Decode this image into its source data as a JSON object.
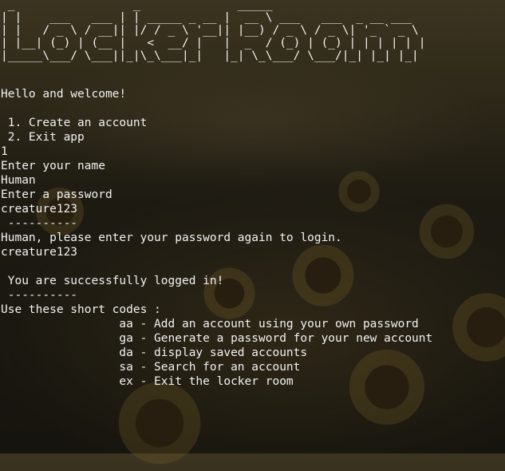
{
  "banner": {
    "ascii_art": " _                 _              _____                       \n| |    ___   ___ | | _____ _ __ |  __ \\ ___   ___  _ __ ___  \n| |   / _ \\ / __|| |/ / _ \\ '__|| |__) / _ \\ / _ \\| '_ ` _ \\ \n| |__| (_) | (__ |   <  __/ |   |  _  / (_) | (_) | | | | | |\n|_____\\___/ \\___||_|\\_\\___|_|   |_| \\_\\___/ \\___/|_| |_| |_|",
    "title": "Locker Room"
  },
  "terminal": {
    "welcome": "Hello and welcome!",
    "menu_option_1": " 1. Create an account",
    "menu_option_2": " 2. Exit app",
    "user_choice": "1",
    "prompt_name": "Enter your name",
    "input_name": "Human",
    "prompt_password": "Enter a password",
    "input_password": "creature123",
    "divider_1": " ----------",
    "login_prompt": "Human, please enter your password again to login.",
    "login_password": "creature123",
    "success_message": " You are successfully logged in!",
    "divider_2": " ----------",
    "short_codes_heading": "Use these short codes :",
    "codes": [
      "                 aa - Add an account using your own password",
      "                 ga - Generate a password for your new account",
      "                 da - display saved accounts",
      "                 sa - Search for an account",
      "                 ex - Exit the locker room"
    ]
  }
}
